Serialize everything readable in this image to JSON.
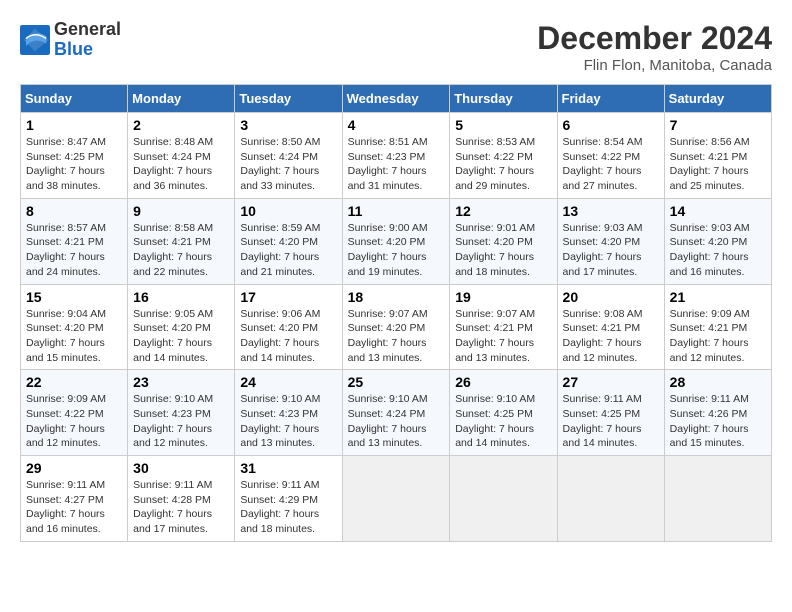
{
  "header": {
    "logo_general": "General",
    "logo_blue": "Blue",
    "month_title": "December 2024",
    "location": "Flin Flon, Manitoba, Canada"
  },
  "weekdays": [
    "Sunday",
    "Monday",
    "Tuesday",
    "Wednesday",
    "Thursday",
    "Friday",
    "Saturday"
  ],
  "weeks": [
    [
      {
        "day": "1",
        "sunrise": "8:47 AM",
        "sunset": "4:25 PM",
        "daylight": "7 hours and 38 minutes."
      },
      {
        "day": "2",
        "sunrise": "8:48 AM",
        "sunset": "4:24 PM",
        "daylight": "7 hours and 36 minutes."
      },
      {
        "day": "3",
        "sunrise": "8:50 AM",
        "sunset": "4:24 PM",
        "daylight": "7 hours and 33 minutes."
      },
      {
        "day": "4",
        "sunrise": "8:51 AM",
        "sunset": "4:23 PM",
        "daylight": "7 hours and 31 minutes."
      },
      {
        "day": "5",
        "sunrise": "8:53 AM",
        "sunset": "4:22 PM",
        "daylight": "7 hours and 29 minutes."
      },
      {
        "day": "6",
        "sunrise": "8:54 AM",
        "sunset": "4:22 PM",
        "daylight": "7 hours and 27 minutes."
      },
      {
        "day": "7",
        "sunrise": "8:56 AM",
        "sunset": "4:21 PM",
        "daylight": "7 hours and 25 minutes."
      }
    ],
    [
      {
        "day": "8",
        "sunrise": "8:57 AM",
        "sunset": "4:21 PM",
        "daylight": "7 hours and 24 minutes."
      },
      {
        "day": "9",
        "sunrise": "8:58 AM",
        "sunset": "4:21 PM",
        "daylight": "7 hours and 22 minutes."
      },
      {
        "day": "10",
        "sunrise": "8:59 AM",
        "sunset": "4:20 PM",
        "daylight": "7 hours and 21 minutes."
      },
      {
        "day": "11",
        "sunrise": "9:00 AM",
        "sunset": "4:20 PM",
        "daylight": "7 hours and 19 minutes."
      },
      {
        "day": "12",
        "sunrise": "9:01 AM",
        "sunset": "4:20 PM",
        "daylight": "7 hours and 18 minutes."
      },
      {
        "day": "13",
        "sunrise": "9:03 AM",
        "sunset": "4:20 PM",
        "daylight": "7 hours and 17 minutes."
      },
      {
        "day": "14",
        "sunrise": "9:03 AM",
        "sunset": "4:20 PM",
        "daylight": "7 hours and 16 minutes."
      }
    ],
    [
      {
        "day": "15",
        "sunrise": "9:04 AM",
        "sunset": "4:20 PM",
        "daylight": "7 hours and 15 minutes."
      },
      {
        "day": "16",
        "sunrise": "9:05 AM",
        "sunset": "4:20 PM",
        "daylight": "7 hours and 14 minutes."
      },
      {
        "day": "17",
        "sunrise": "9:06 AM",
        "sunset": "4:20 PM",
        "daylight": "7 hours and 14 minutes."
      },
      {
        "day": "18",
        "sunrise": "9:07 AM",
        "sunset": "4:20 PM",
        "daylight": "7 hours and 13 minutes."
      },
      {
        "day": "19",
        "sunrise": "9:07 AM",
        "sunset": "4:21 PM",
        "daylight": "7 hours and 13 minutes."
      },
      {
        "day": "20",
        "sunrise": "9:08 AM",
        "sunset": "4:21 PM",
        "daylight": "7 hours and 12 minutes."
      },
      {
        "day": "21",
        "sunrise": "9:09 AM",
        "sunset": "4:21 PM",
        "daylight": "7 hours and 12 minutes."
      }
    ],
    [
      {
        "day": "22",
        "sunrise": "9:09 AM",
        "sunset": "4:22 PM",
        "daylight": "7 hours and 12 minutes."
      },
      {
        "day": "23",
        "sunrise": "9:10 AM",
        "sunset": "4:23 PM",
        "daylight": "7 hours and 12 minutes."
      },
      {
        "day": "24",
        "sunrise": "9:10 AM",
        "sunset": "4:23 PM",
        "daylight": "7 hours and 13 minutes."
      },
      {
        "day": "25",
        "sunrise": "9:10 AM",
        "sunset": "4:24 PM",
        "daylight": "7 hours and 13 minutes."
      },
      {
        "day": "26",
        "sunrise": "9:10 AM",
        "sunset": "4:25 PM",
        "daylight": "7 hours and 14 minutes."
      },
      {
        "day": "27",
        "sunrise": "9:11 AM",
        "sunset": "4:25 PM",
        "daylight": "7 hours and 14 minutes."
      },
      {
        "day": "28",
        "sunrise": "9:11 AM",
        "sunset": "4:26 PM",
        "daylight": "7 hours and 15 minutes."
      }
    ],
    [
      {
        "day": "29",
        "sunrise": "9:11 AM",
        "sunset": "4:27 PM",
        "daylight": "7 hours and 16 minutes."
      },
      {
        "day": "30",
        "sunrise": "9:11 AM",
        "sunset": "4:28 PM",
        "daylight": "7 hours and 17 minutes."
      },
      {
        "day": "31",
        "sunrise": "9:11 AM",
        "sunset": "4:29 PM",
        "daylight": "7 hours and 18 minutes."
      },
      null,
      null,
      null,
      null
    ]
  ],
  "labels": {
    "sunrise_prefix": "Sunrise: ",
    "sunset_prefix": "Sunset: ",
    "daylight_prefix": "Daylight: "
  }
}
